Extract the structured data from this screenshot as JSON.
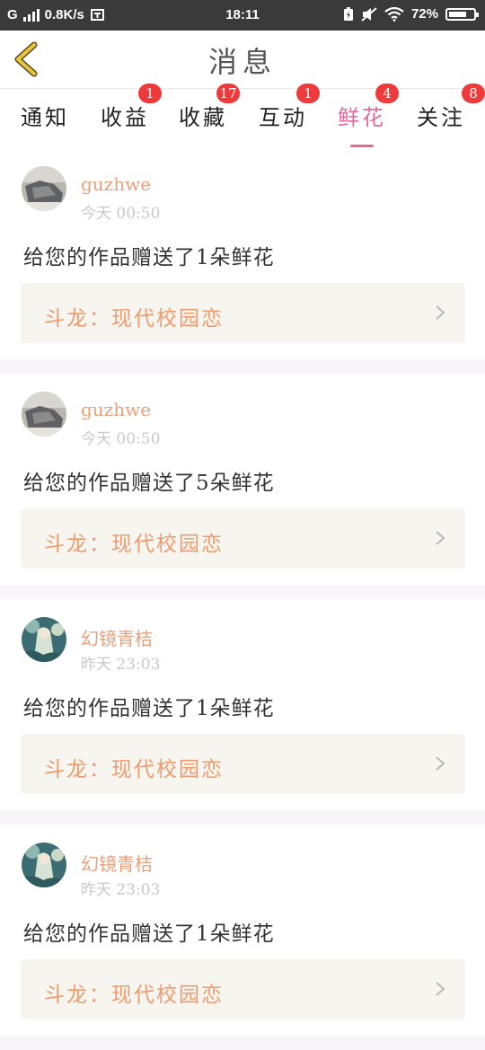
{
  "status_bar": {
    "carrier": "G",
    "speed": "0.8K/s",
    "time": "18:11",
    "battery_text": "72%",
    "battery_level": 0.72
  },
  "header": {
    "title": "消息",
    "back_icon": "chevron-left-icon",
    "accent_color": "#e8c440"
  },
  "tabs": [
    {
      "label": "通知",
      "badge": ""
    },
    {
      "label": "收益",
      "badge": "1"
    },
    {
      "label": "收藏",
      "badge": "17"
    },
    {
      "label": "互动",
      "badge": "1"
    },
    {
      "label": "鲜花",
      "badge": "4",
      "active": true
    },
    {
      "label": "关注",
      "badge": "8"
    }
  ],
  "colors": {
    "active_tab": "#e26a9a",
    "badge": "#ee3a3a",
    "username": "#e8a07a",
    "work_title": "#ee9b6d"
  },
  "messages": [
    {
      "user": "guzhwe",
      "time": "今天 00:50",
      "text": "给您的作品赠送了1朵鲜花",
      "work": "斗龙：现代校园恋"
    },
    {
      "user": "guzhwe",
      "time": "今天 00:50",
      "text": "给您的作品赠送了5朵鲜花",
      "work": "斗龙：现代校园恋"
    },
    {
      "user": "幻镜青桔",
      "time": "昨天 23:03",
      "text": "给您的作品赠送了1朵鲜花",
      "work": "斗龙：现代校园恋"
    },
    {
      "user": "幻镜青桔",
      "time": "昨天 23:03",
      "text": "给您的作品赠送了1朵鲜花",
      "work": "斗龙：现代校园恋"
    }
  ]
}
